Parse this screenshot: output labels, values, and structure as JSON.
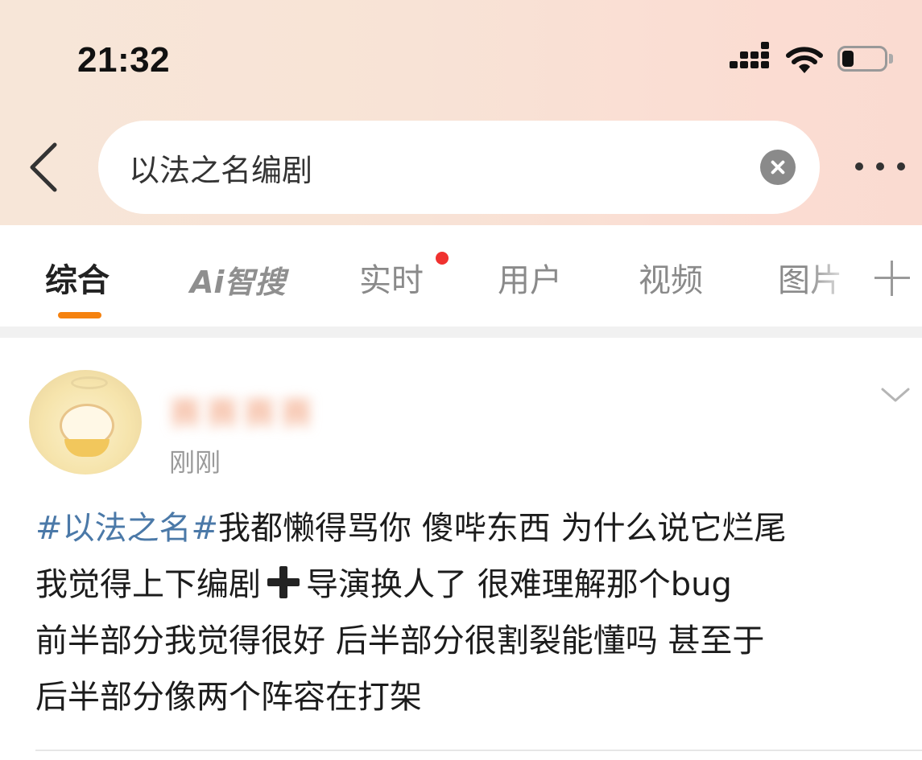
{
  "status_bar": {
    "time": "21:32",
    "icons": [
      "signal-icon",
      "wifi-icon",
      "battery-icon"
    ]
  },
  "search": {
    "query": "以法之名编剧",
    "icons": [
      "back-arrow-icon",
      "clear-icon",
      "more-dots-icon"
    ]
  },
  "tabs": {
    "items": [
      "综合",
      "Ai智搜",
      "实时",
      "用户",
      "视频",
      "图片"
    ],
    "active": "综合",
    "accent": "#f5820f",
    "notification_dot_color": "#f0312f"
  },
  "post": {
    "username": "赛赛赛赛",
    "timestamp": "刚刚",
    "hashtag": "#以法之名#",
    "text_line1": "我都懒得骂你 傻哔东西 为什么说它烂尾",
    "text_line2a": "我觉得上下编剧",
    "text_line2b": "导演换人了 很难理解那个bug",
    "text_line3": "前半部分我觉得很好 后半部分很割裂能懂吗 甚至于",
    "text_line4": "后半部分像两个阵容在打架",
    "hashtag_color": "#4b79a8"
  }
}
